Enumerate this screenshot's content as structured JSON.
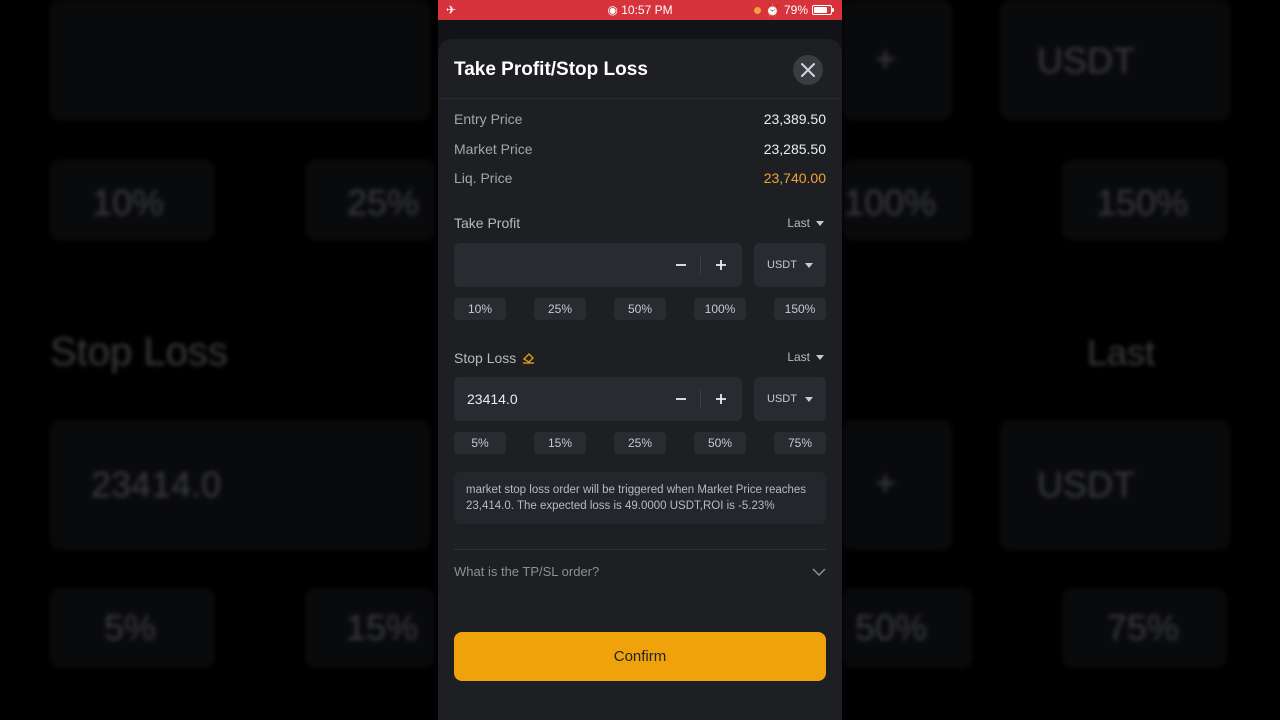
{
  "status_bar": {
    "time": "10:57 PM",
    "battery": "79%",
    "battery_level": 0.79,
    "airplane_icon": "airplane-icon",
    "alarm_icon": "alarm-icon"
  },
  "background": {
    "pct_row_1": [
      "10%",
      "25%",
      "100%",
      "150%"
    ],
    "stop_loss_label": "Stop Loss",
    "last_label": "Last",
    "usdt_label": "USDT",
    "stop_value": "23414.0",
    "pct_row_2": [
      "5%",
      "15%",
      "50%",
      "75%"
    ]
  },
  "sheet": {
    "title": "Take Profit/Stop Loss",
    "entry_price_label": "Entry Price",
    "entry_price_value": "23,389.50",
    "market_price_label": "Market Price",
    "market_price_value": "23,285.50",
    "liq_price_label": "Liq. Price",
    "liq_price_value": "23,740.00",
    "take_profit": {
      "title": "Take Profit",
      "price_type": "Last",
      "value": "",
      "unit": "USDT",
      "percents": [
        "10%",
        "25%",
        "50%",
        "100%",
        "150%"
      ]
    },
    "stop_loss": {
      "title": "Stop Loss",
      "price_type": "Last",
      "value": "23414.0",
      "unit": "USDT",
      "percents": [
        "5%",
        "15%",
        "25%",
        "50%",
        "75%"
      ]
    },
    "info_text": "market stop loss order will be triggered when Market Price reaches 23,414.0. The expected loss is 49.0000 USDT,ROI is -5.23%",
    "faq_label": "What is the TP/SL order?",
    "confirm_label": "Confirm"
  },
  "colors": {
    "accent": "#f0a20b",
    "liq_price": "#f0a33a",
    "status_bar": "#d6333c"
  }
}
